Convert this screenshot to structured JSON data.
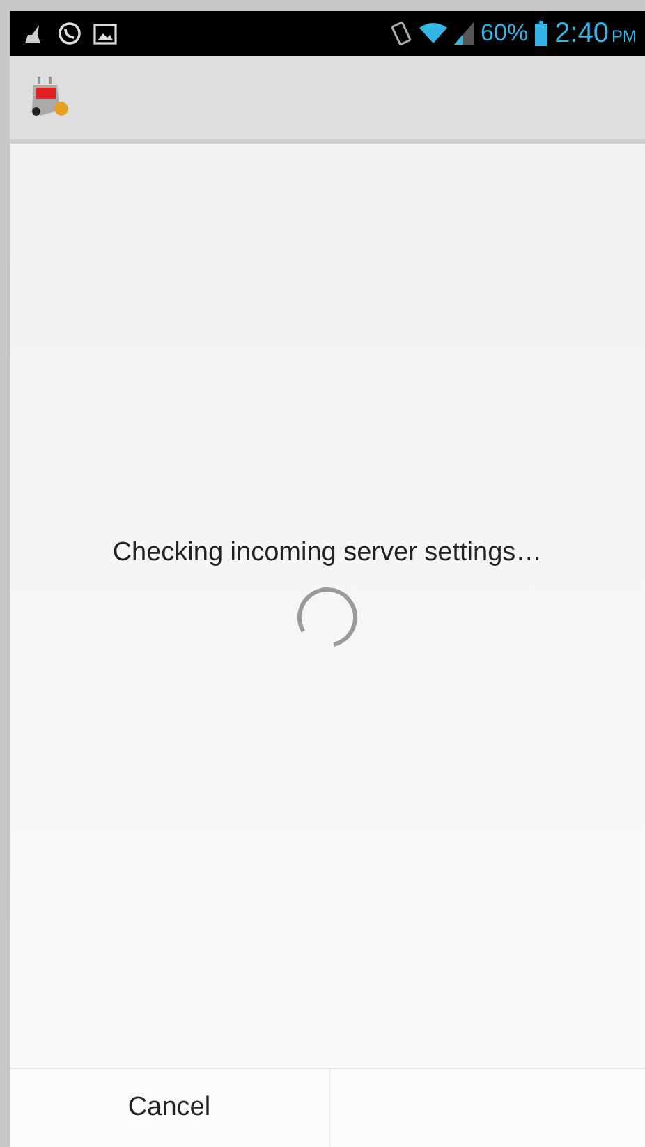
{
  "status_bar": {
    "battery": "60%",
    "time": "2:40",
    "meridiem": "PM"
  },
  "message": "Checking incoming server settings…",
  "buttons": [
    {
      "label": "Cancel"
    }
  ]
}
